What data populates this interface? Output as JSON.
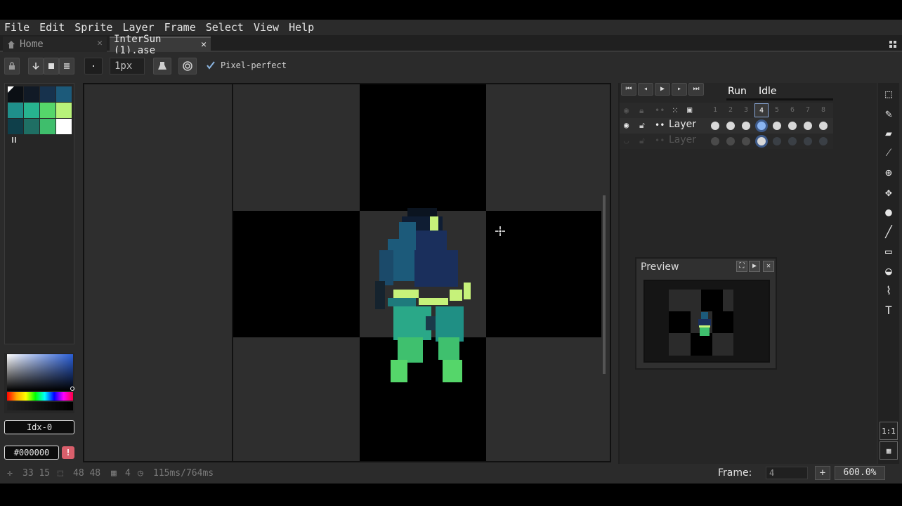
{
  "menu": [
    "File",
    "Edit",
    "Sprite",
    "Layer",
    "Frame",
    "Select",
    "View",
    "Help"
  ],
  "tabs": [
    {
      "label": "Home",
      "close": "✕"
    },
    {
      "label": "InterSun (1).ase",
      "close": "✕"
    }
  ],
  "context_bar": {
    "brush_size": "1px",
    "pixel_perfect_label": "Pixel-perfect",
    "pixel_perfect_checked": true
  },
  "palette": {
    "colors": [
      "#0b0f14",
      "#111a26",
      "#17324d",
      "#1c5a7a",
      "#1f8f8a",
      "#27b38f",
      "#55d66a",
      "#b8f27a",
      "#0f3f4a",
      "#1f6f64",
      "#3fbe6c",
      "#ffffff"
    ],
    "selected_index": 0
  },
  "color": {
    "index_label": "Idx-0",
    "hex_label": "#000000",
    "warning_icon": "!"
  },
  "timeline": {
    "tags": [
      "Run",
      "Idle"
    ],
    "frames": [
      "1",
      "2",
      "3",
      "4",
      "5",
      "6",
      "7",
      "8"
    ],
    "current_frame": "4",
    "layers": [
      {
        "name": "Layer",
        "visible": true
      },
      {
        "name": "Layer",
        "visible": false
      }
    ]
  },
  "preview": {
    "title": "Preview"
  },
  "status": {
    "position": "33 15",
    "size": "48 48",
    "frame_count": "4",
    "duration": "115ms/764ms",
    "frame_label": "Frame:",
    "frame_value": "4",
    "plus": "+",
    "zoom": "600.0%"
  },
  "tools": [
    "rect-select-icon",
    "pencil-icon",
    "eraser-icon",
    "eyedropper-icon",
    "zoom-icon",
    "move-icon",
    "fill-icon",
    "line-icon",
    "rectangle-icon",
    "blur-icon",
    "smudge-icon",
    "text-icon"
  ],
  "tool_glyphs": [
    "⬚",
    "✎",
    "▰",
    "⁄",
    "⊕",
    "✥",
    "●",
    "╱",
    "▭",
    "◒",
    "⌇",
    "T"
  ],
  "bottom_tools": [
    {
      "name": "actual-size-button",
      "label": "1:1"
    },
    {
      "name": "grid-view-button",
      "label": "▦"
    }
  ]
}
